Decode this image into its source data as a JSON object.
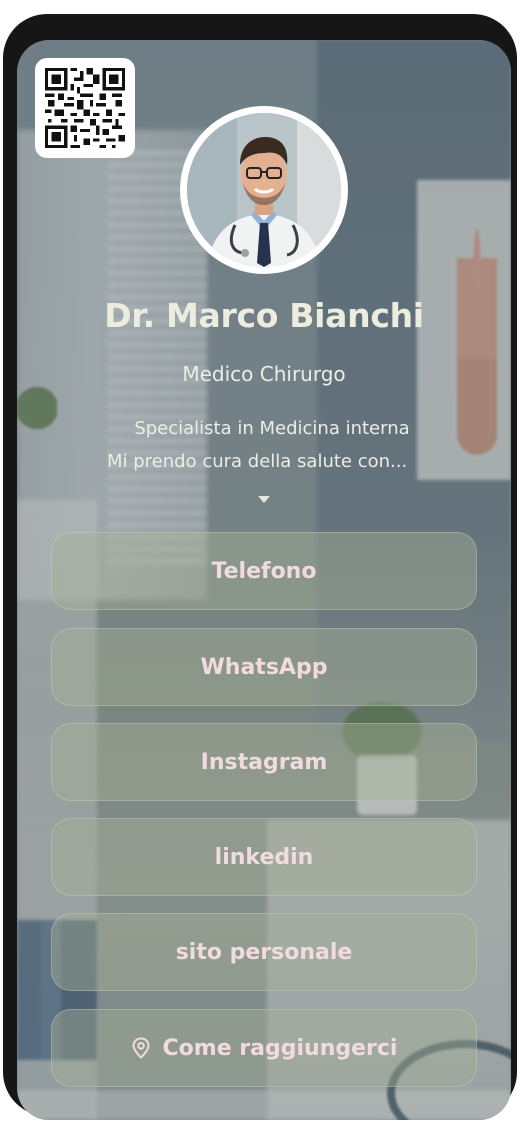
{
  "profile": {
    "name": "Dr. Marco Bianchi",
    "title": "Medico Chirurgo",
    "bio_line1": "Specialista in Medicina interna",
    "bio_line2": "Mi prendo cura della salute con..."
  },
  "actions": [
    {
      "label": "Telefono",
      "icon": ""
    },
    {
      "label": "WhatsApp",
      "icon": ""
    },
    {
      "label": "Instagram",
      "icon": ""
    },
    {
      "label": "linkedin",
      "icon": ""
    },
    {
      "label": "sito personale",
      "icon": ""
    },
    {
      "label": "Come raggiungerci",
      "icon": "map-pin-icon"
    }
  ],
  "colors": {
    "button_text": "#f1dbe0",
    "heading_text": "#ededdf",
    "frame": "#161616"
  }
}
